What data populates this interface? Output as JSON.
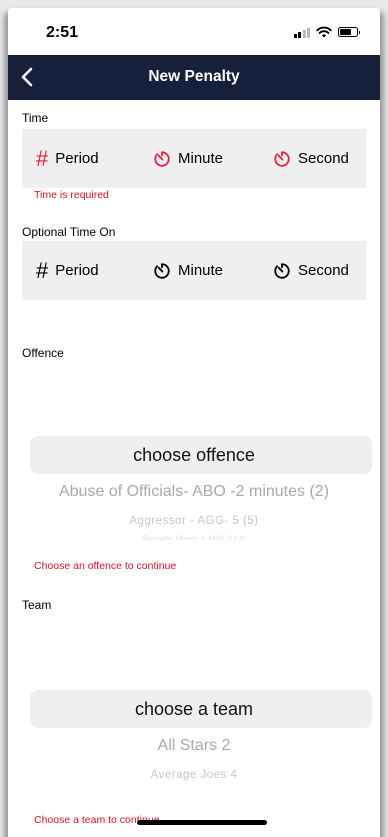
{
  "status_bar": {
    "time": "2:51"
  },
  "nav": {
    "title": "New Penalty"
  },
  "time_section": {
    "label": "Time",
    "period": "Period",
    "minute": "Minute",
    "second": "Second",
    "error": "Time is required"
  },
  "time_on_section": {
    "label": "Optional Time On",
    "period": "Period",
    "minute": "Minute",
    "second": "Second"
  },
  "offence_section": {
    "label": "Offence",
    "selected": "choose offence",
    "options": [
      "Abuse of Officials- ABO -2 minutes (2)",
      "Aggressor - AGG- 5 (5)",
      "Penalty Minor + MIS 2 (2)"
    ],
    "error": "Choose an offence to continue"
  },
  "team_section": {
    "label": "Team",
    "selected": "choose a team",
    "options": [
      "All Stars 2",
      "Average Joes 4"
    ],
    "error": "Choose a team to continue"
  },
  "colors": {
    "nav_background": "#16203a",
    "error_red": "#d0122c",
    "icon_red": "#e61e3c",
    "field_background": "#efeff1"
  }
}
